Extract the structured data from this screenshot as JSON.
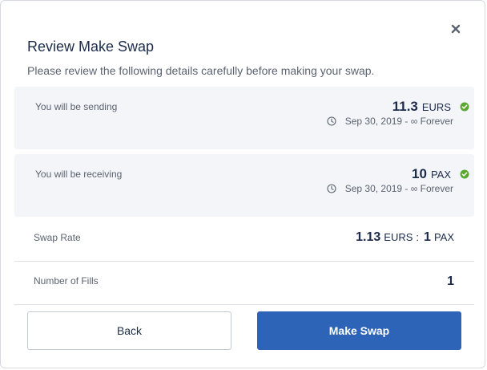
{
  "modal": {
    "title": "Review Make Swap",
    "subtitle": "Please review the following details carefully before making your swap."
  },
  "sending": {
    "label": "You will be sending",
    "amount": "11.3",
    "unit": "EURS",
    "date": "Sep 30, 2019 - ∞ Forever"
  },
  "receiving": {
    "label": "You will be receiving",
    "amount": "10",
    "unit": "PAX",
    "date": "Sep 30, 2019 - ∞ Forever"
  },
  "swap_rate": {
    "label": "Swap Rate",
    "left_value": "1.13",
    "left_unit": "EURS",
    "separator": ":",
    "right_value": "1",
    "right_unit": "PAX"
  },
  "fills": {
    "label": "Number of Fills",
    "value": "1"
  },
  "buttons": {
    "back": "Back",
    "make_swap": "Make Swap"
  },
  "icons": {
    "close": "close-icon",
    "check": "check-circle-icon",
    "clock": "clock-icon"
  },
  "colors": {
    "primary": "#2e64b7",
    "success": "#5aa832",
    "text_dark": "#1c2b4a",
    "text_muted": "#5b6270",
    "panel_bg": "#f3f5f8"
  }
}
